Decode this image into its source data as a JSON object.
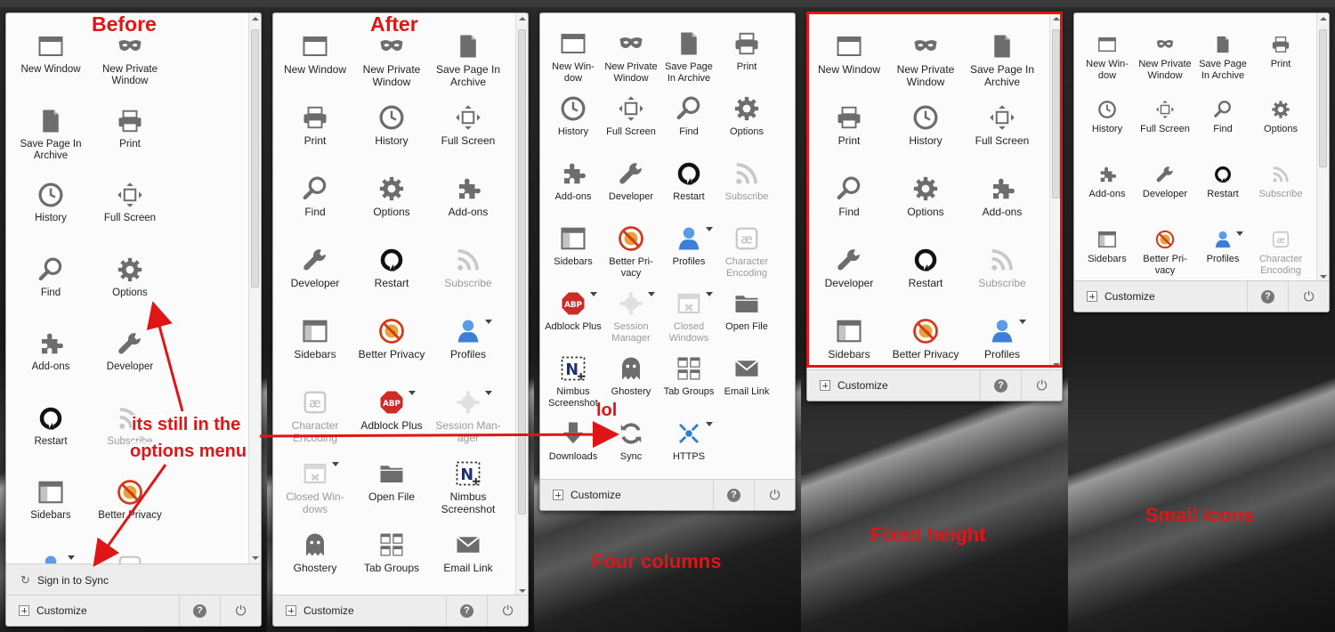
{
  "panels": [
    {
      "name": "before",
      "items": [
        {
          "label": "New Window",
          "icon": "window-icon"
        },
        {
          "label": "New Private Window",
          "icon": "mask-icon"
        },
        {
          "label": "Save Page In Archive",
          "icon": "page-icon"
        },
        {
          "label": "Print",
          "icon": "printer-icon"
        },
        {
          "label": "History",
          "icon": "clock-icon"
        },
        {
          "label": "Full Screen",
          "icon": "fullscreen-icon"
        },
        {
          "label": "Find",
          "icon": "magnifier-icon"
        },
        {
          "label": "Options",
          "icon": "gear-icon"
        },
        {
          "label": "Add-ons",
          "icon": "puzzle-icon"
        },
        {
          "label": "Developer",
          "icon": "wrench-icon"
        },
        {
          "label": "Restart",
          "icon": "restart-icon"
        },
        {
          "label": "Subscribe",
          "icon": "rss-icon",
          "disabled": true
        },
        {
          "label": "Sidebars",
          "icon": "sidebar-icon"
        },
        {
          "label": "Better Privacy",
          "icon": "no-cookie-icon"
        },
        {
          "label": "",
          "icon": "profile-icon",
          "dropdown": true
        },
        {
          "label": "",
          "icon": "encoding-icon",
          "disabled": true
        }
      ],
      "sync_label": "Sign in to Sync",
      "customize": "Customize"
    },
    {
      "name": "after",
      "items": [
        {
          "label": "New Window",
          "icon": "window-icon"
        },
        {
          "label": "New Private Window",
          "icon": "mask-icon"
        },
        {
          "label": "Save Page In Archive",
          "icon": "page-icon"
        },
        {
          "label": "Print",
          "icon": "printer-icon"
        },
        {
          "label": "History",
          "icon": "clock-icon"
        },
        {
          "label": "Full Screen",
          "icon": "fullscreen-icon"
        },
        {
          "label": "Find",
          "icon": "magnifier-icon"
        },
        {
          "label": "Options",
          "icon": "gear-icon"
        },
        {
          "label": "Add-ons",
          "icon": "puzzle-icon"
        },
        {
          "label": "Developer",
          "icon": "wrench-icon"
        },
        {
          "label": "Restart",
          "icon": "restart-icon"
        },
        {
          "label": "Subscribe",
          "icon": "rss-icon",
          "disabled": true
        },
        {
          "label": "Sidebars",
          "icon": "sidebar-icon"
        },
        {
          "label": "Better Privacy",
          "icon": "no-cookie-icon"
        },
        {
          "label": "Profiles",
          "icon": "profile-icon",
          "dropdown": true
        },
        {
          "label": "Character Encoding",
          "icon": "encoding-icon",
          "disabled": true
        },
        {
          "label": "Adblock Plus",
          "icon": "abp-icon",
          "dropdown": true
        },
        {
          "label": "Session Man-ager",
          "icon": "session-icon",
          "disabled": true,
          "dropdown": true
        },
        {
          "label": "Closed Win-dows",
          "icon": "closed-windows-icon",
          "disabled": true,
          "dropdown": true
        },
        {
          "label": "Open File",
          "icon": "folder-icon"
        },
        {
          "label": "Nimbus Screenshot",
          "icon": "nimbus-icon"
        },
        {
          "label": "Ghostery",
          "icon": "ghost-icon"
        },
        {
          "label": "Tab Groups",
          "icon": "tab-groups-icon"
        },
        {
          "label": "Email Link",
          "icon": "email-icon"
        }
      ],
      "customize": "Customize"
    },
    {
      "name": "four-columns",
      "items": [
        {
          "label": "New Win-dow",
          "icon": "window-icon"
        },
        {
          "label": "New Private Window",
          "icon": "mask-icon"
        },
        {
          "label": "Save Page In Archive",
          "icon": "page-icon"
        },
        {
          "label": "Print",
          "icon": "printer-icon"
        },
        {
          "label": "History",
          "icon": "clock-icon"
        },
        {
          "label": "Full Screen",
          "icon": "fullscreen-icon"
        },
        {
          "label": "Find",
          "icon": "magnifier-icon"
        },
        {
          "label": "Options",
          "icon": "gear-icon"
        },
        {
          "label": "Add-ons",
          "icon": "puzzle-icon"
        },
        {
          "label": "Developer",
          "icon": "wrench-icon"
        },
        {
          "label": "Restart",
          "icon": "restart-icon"
        },
        {
          "label": "Subscribe",
          "icon": "rss-icon",
          "disabled": true
        },
        {
          "label": "Sidebars",
          "icon": "sidebar-icon"
        },
        {
          "label": "Better Pri-vacy",
          "icon": "no-cookie-icon"
        },
        {
          "label": "Profiles",
          "icon": "profile-icon",
          "dropdown": true
        },
        {
          "label": "Character Encoding",
          "icon": "encoding-icon",
          "disabled": true
        },
        {
          "label": "Adblock Plus",
          "icon": "abp-icon",
          "dropdown": true
        },
        {
          "label": "Session Manager",
          "icon": "session-icon",
          "disabled": true,
          "dropdown": true
        },
        {
          "label": "Closed Windows",
          "icon": "closed-windows-icon",
          "disabled": true,
          "dropdown": true
        },
        {
          "label": "Open File",
          "icon": "folder-icon"
        },
        {
          "label": "Nimbus Screenshot",
          "icon": "nimbus-icon"
        },
        {
          "label": "Ghostery",
          "icon": "ghost-icon"
        },
        {
          "label": "Tab Groups",
          "icon": "tab-groups-icon"
        },
        {
          "label": "Email Link",
          "icon": "email-icon"
        },
        {
          "label": "Downloads",
          "icon": "download-icon"
        },
        {
          "label": "Sync",
          "icon": "sync-icon"
        },
        {
          "label": "HTTPS",
          "icon": "https-icon",
          "dropdown": true
        }
      ],
      "customize": "Customize"
    },
    {
      "name": "fixed-height",
      "items": [
        {
          "label": "New Window",
          "icon": "window-icon"
        },
        {
          "label": "New Private Window",
          "icon": "mask-icon"
        },
        {
          "label": "Save Page In Archive",
          "icon": "page-icon"
        },
        {
          "label": "Print",
          "icon": "printer-icon"
        },
        {
          "label": "History",
          "icon": "clock-icon"
        },
        {
          "label": "Full Screen",
          "icon": "fullscreen-icon"
        },
        {
          "label": "Find",
          "icon": "magnifier-icon"
        },
        {
          "label": "Options",
          "icon": "gear-icon"
        },
        {
          "label": "Add-ons",
          "icon": "puzzle-icon"
        },
        {
          "label": "Developer",
          "icon": "wrench-icon"
        },
        {
          "label": "Restart",
          "icon": "restart-icon"
        },
        {
          "label": "Subscribe",
          "icon": "rss-icon",
          "disabled": true
        },
        {
          "label": "Sidebars",
          "icon": "sidebar-icon"
        },
        {
          "label": "Better Privacy",
          "icon": "no-cookie-icon"
        },
        {
          "label": "Profiles",
          "icon": "profile-icon",
          "dropdown": true
        }
      ],
      "customize": "Customize"
    },
    {
      "name": "small-icons",
      "items": [
        {
          "label": "New Win-dow",
          "icon": "window-icon"
        },
        {
          "label": "New Private Window",
          "icon": "mask-icon"
        },
        {
          "label": "Save Page In Archive",
          "icon": "page-icon"
        },
        {
          "label": "Print",
          "icon": "printer-icon"
        },
        {
          "label": "History",
          "icon": "clock-icon"
        },
        {
          "label": "Full Screen",
          "icon": "fullscreen-icon"
        },
        {
          "label": "Find",
          "icon": "magnifier-icon"
        },
        {
          "label": "Options",
          "icon": "gear-icon"
        },
        {
          "label": "Add-ons",
          "icon": "puzzle-icon"
        },
        {
          "label": "Developer",
          "icon": "wrench-icon"
        },
        {
          "label": "Restart",
          "icon": "restart-icon"
        },
        {
          "label": "Subscribe",
          "icon": "rss-icon",
          "disabled": true
        },
        {
          "label": "Sidebars",
          "icon": "sidebar-icon"
        },
        {
          "label": "Better Pri-vacy",
          "icon": "no-cookie-icon"
        },
        {
          "label": "Profiles",
          "icon": "profile-icon",
          "dropdown": true
        },
        {
          "label": "Character Encoding",
          "icon": "encoding-icon",
          "disabled": true
        }
      ],
      "customize": "Customize"
    }
  ],
  "annotations": {
    "before": "Before",
    "after": "After",
    "still_line1": "its still in the",
    "still_line2": "options menu",
    "lol": "lol",
    "four_columns": "Four columns",
    "fixed_height": "Fixed height",
    "small_icons": "Small icons"
  },
  "colors": {
    "annotation": "#e01515",
    "panel": "#fbfbfb",
    "footer": "#ededed"
  }
}
